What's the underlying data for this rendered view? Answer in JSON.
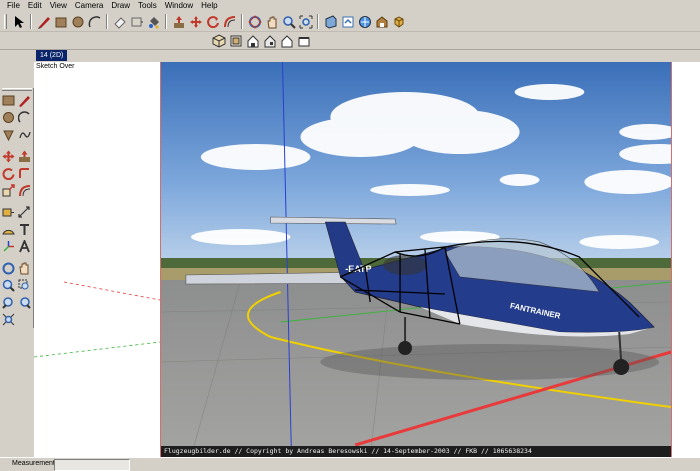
{
  "menu": [
    "File",
    "Edit",
    "View",
    "Camera",
    "Draw",
    "Tools",
    "Window",
    "Help"
  ],
  "toolbar_main_icons": [
    {
      "name": "select-arrow-icon",
      "color": "#000000"
    },
    {
      "name": "pencil-line-icon",
      "color": "#b02020"
    },
    {
      "name": "rectangle-icon",
      "color": "#8a6d45"
    },
    {
      "name": "circle-icon",
      "color": "#8a6d45"
    },
    {
      "name": "arc-icon",
      "color": "#333333"
    },
    {
      "name": "eraser-icon",
      "color": "#e0e0e0"
    },
    {
      "name": "tape-measure-icon",
      "color": "#c8c4ba"
    },
    {
      "name": "paint-bucket-icon",
      "color": "#555555"
    },
    {
      "name": "push-pull-icon",
      "color": "#c0392b"
    },
    {
      "name": "move-icon",
      "color": "#c0392b"
    },
    {
      "name": "rotate-icon",
      "color": "#c0392b"
    },
    {
      "name": "offset-icon",
      "color": "#c0392b"
    },
    {
      "name": "orbit-icon",
      "color": "#3060b0"
    },
    {
      "name": "pan-hand-icon",
      "color": "#e8d2b0"
    },
    {
      "name": "zoom-icon",
      "color": "#3060b0"
    },
    {
      "name": "zoom-extents-icon",
      "color": "#3060b0"
    },
    {
      "name": "section-plane-icon",
      "color": "#4a7fc0"
    },
    {
      "name": "get-models-icon",
      "color": "#3c6fb0"
    },
    {
      "name": "share-model-icon",
      "color": "#3c6fb0"
    },
    {
      "name": "warehouse-icon",
      "color": "#7b5a2a"
    },
    {
      "name": "component-icon",
      "color": "#b08030"
    }
  ],
  "toolbar_view_icons": [
    {
      "name": "iso-view-icon"
    },
    {
      "name": "top-view-icon"
    },
    {
      "name": "front-view-icon"
    },
    {
      "name": "right-view-icon"
    },
    {
      "name": "back-view-icon"
    },
    {
      "name": "left-view-icon"
    }
  ],
  "scene_tab": "14 (2D)",
  "viewport_label": "Sketch Over",
  "photo": {
    "credit": "Flugzeugbilder.de // Copyright by Andreas Beresowski // 14-September-2003 // FKB // 1065638234",
    "aircraft_registration": "-EATP",
    "aircraft_text": "FANTRAINER"
  },
  "status": {
    "measurements_label": "Measurements"
  },
  "colors": {
    "window_bg": "#d4d0c8",
    "scene_tab": "#0a246a",
    "sky_top": "#3a6fb8",
    "axis_red": "#e83a3a",
    "axis_green": "#3ab53a",
    "axis_blue": "#2a3fd0"
  }
}
